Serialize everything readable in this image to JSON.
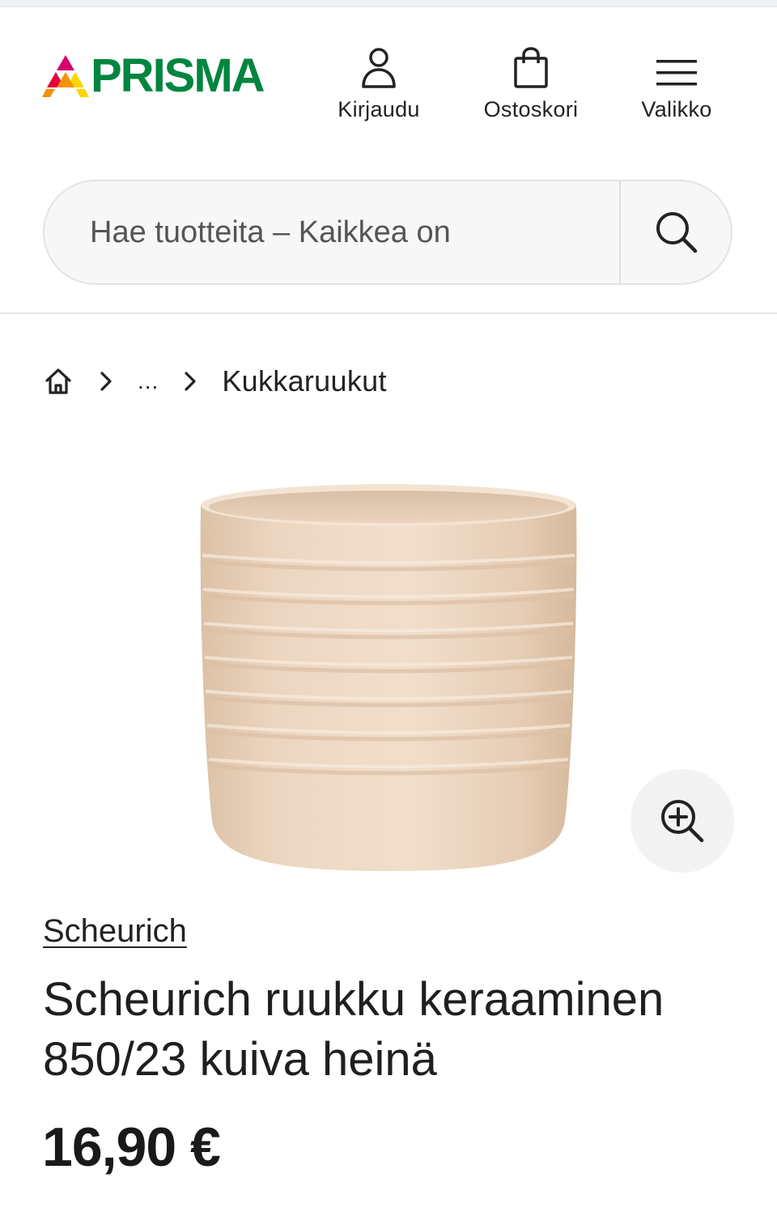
{
  "header": {
    "logo_text": "PRISMA",
    "nav": {
      "login_label": "Kirjaudu",
      "cart_label": "Ostoskori",
      "menu_label": "Valikko"
    }
  },
  "search": {
    "placeholder": "Hae tuotteita – Kaikkea on"
  },
  "breadcrumb": {
    "ellipsis": "...",
    "current": "Kukkaruukut"
  },
  "product": {
    "brand": "Scheurich",
    "title": "Scheurich ruukku keraaminen 850/23 kuiva heinä",
    "price": "16,90 €",
    "pot_color": "#ecd6c0"
  },
  "colors": {
    "brand_green": "#00853f",
    "logo_red": "#e4003a",
    "logo_orange": "#f39200",
    "logo_yellow": "#ffd600",
    "logo_magenta": "#d6006d"
  }
}
